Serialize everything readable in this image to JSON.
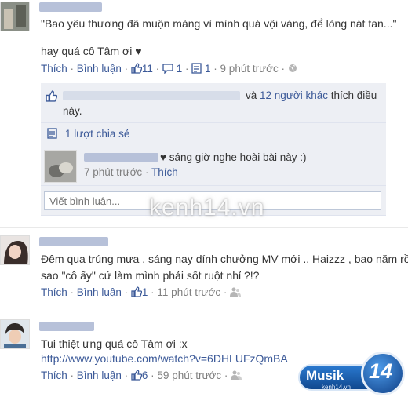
{
  "comment1": {
    "quote": "\"Bao yêu thương đã muộn màng vì mình quá vội vàng, để lòng nát tan...\"",
    "text": "hay quá cô Tâm ơi ♥",
    "like_link": "Thích",
    "comment_link": "Bình luận",
    "likes": "11",
    "comments": "1",
    "shares": "1",
    "time": "9 phút trước"
  },
  "likes_box": {
    "and_text": "và",
    "others": "12 người khác",
    "like_text": "thích điều",
    "like_text2": "này."
  },
  "share_row": {
    "label": "1 lượt chia sẻ"
  },
  "reply": {
    "text": "♥ sáng giờ nghe hoài bài này :)",
    "time": "7 phút trước",
    "like_link": "Thích"
  },
  "reply_input": {
    "placeholder": "Viết bình luận..."
  },
  "comment2": {
    "line1": "Đêm qua trúng mưa , sáng nay dính chưởng MV mới .. Haizzz , bao năm rồi",
    "line2": "sao \"cô ấy\" cứ làm mình phải sốt ruột nhỉ ?!?",
    "like_link": "Thích",
    "comment_link": "Bình luận",
    "likes": "1",
    "time": "11 phút trước"
  },
  "comment3": {
    "text": "Tui thiệt ưng quá cô Tâm ơi :x",
    "url": "http://www.youtube.com/watch?v=6DHLUFzQmBA",
    "like_link": "Thích",
    "comment_link": "Bình luận",
    "likes": "6",
    "time": "59 phút trước"
  },
  "watermark": {
    "text": "kenh14.vn"
  },
  "badge": {
    "name": "Musik",
    "number": "14",
    "site": "kenh14.vn"
  },
  "colors": {
    "link": "#3b5998",
    "meta": "#7f7f7f",
    "likes_bg": "#edeff4",
    "badge": "#1d5fb4"
  }
}
